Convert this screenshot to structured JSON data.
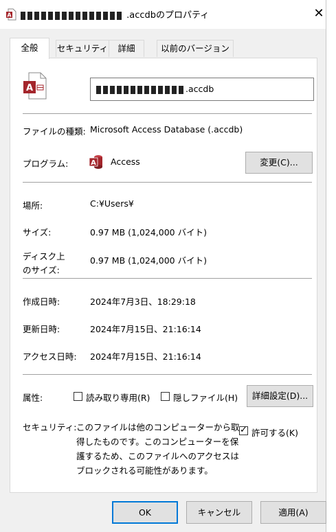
{
  "window": {
    "title": ".accdbのプロパティ",
    "close_glyph": "✕"
  },
  "tabs": [
    {
      "label": "全般",
      "active": true
    },
    {
      "label": "セキュリティ",
      "active": false
    },
    {
      "label": "詳細",
      "active": false
    },
    {
      "label": "以前のバージョン",
      "active": false
    }
  ],
  "general": {
    "filename_suffix": ".accdb",
    "file_type_label": "ファイルの種類:",
    "file_type_value": "Microsoft Access Database (.accdb)",
    "program_label": "プログラム:",
    "program_value": "Access",
    "change_button": "変更(C)...",
    "location_label": "場所:",
    "location_value": "C:¥Users¥",
    "size_label": "サイズ:",
    "size_value": "0.97 MB (1,024,000 バイト)",
    "disk_size_label_1": "ディスク上",
    "disk_size_label_2": "のサイズ:",
    "disk_size_value": "0.97 MB (1,024,000 バイト)",
    "created_label": "作成日時:",
    "created_value": "2024年7月3日、18:29:18",
    "modified_label": "更新日時:",
    "modified_value": "2024年7月15日、21:16:14",
    "accessed_label": "アクセス日時:",
    "accessed_value": "2024年7月15日、21:16:14",
    "attributes_label": "属性:",
    "readonly_label": "読み取り専用(R)",
    "readonly_checked": false,
    "hidden_label": "隠しファイル(H)",
    "hidden_checked": false,
    "advanced_button": "詳細設定(D)...",
    "security_label": "セキュリティ:",
    "security_text_1": "このファイルは他のコンピューターから取",
    "security_text_2": "得したものです。このコンピューターを保",
    "security_text_3": "護するため、このファイルへのアクセスは",
    "security_text_4": "ブロックされる可能性があります。",
    "unblock_label": "許可する(K)",
    "unblock_checked": true,
    "check_glyph": "✓"
  },
  "footer": {
    "ok": "OK",
    "cancel": "キャンセル",
    "apply": "適用(A)"
  },
  "colors": {
    "access_red": "#a4262c",
    "focus_blue": "#0078d7"
  }
}
